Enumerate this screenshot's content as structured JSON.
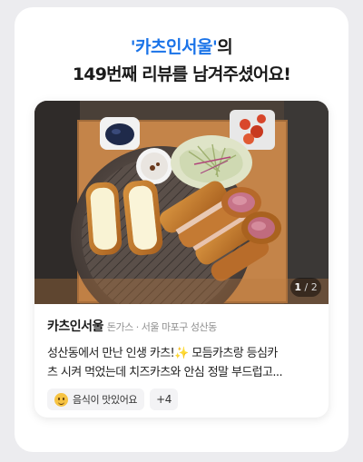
{
  "theme": {
    "accent": "#1a73e8"
  },
  "headline": {
    "store_quoted": "'카츠인서울'",
    "suffix": "의",
    "line2": "149번째 리뷰를 남겨주셨어요!"
  },
  "review": {
    "photo_icon": "tonkatsu-photo",
    "pager": {
      "current": "1",
      "separator": "/",
      "total": "2"
    },
    "store_name": "카츠인서울",
    "category": "돈가스 · 서울 마포구 성산동",
    "text_line1": "성산동에서 만난 인생 카츠!✨ 모듬카츠랑 등심카",
    "text_line2": "츠 시켜 먹었는데 치즈카츠와 안심 정말 부드럽고...",
    "tag_icon": "smile-emoji-icon",
    "tag_label": "음식이 맛있어요",
    "more_tags": "+4"
  }
}
